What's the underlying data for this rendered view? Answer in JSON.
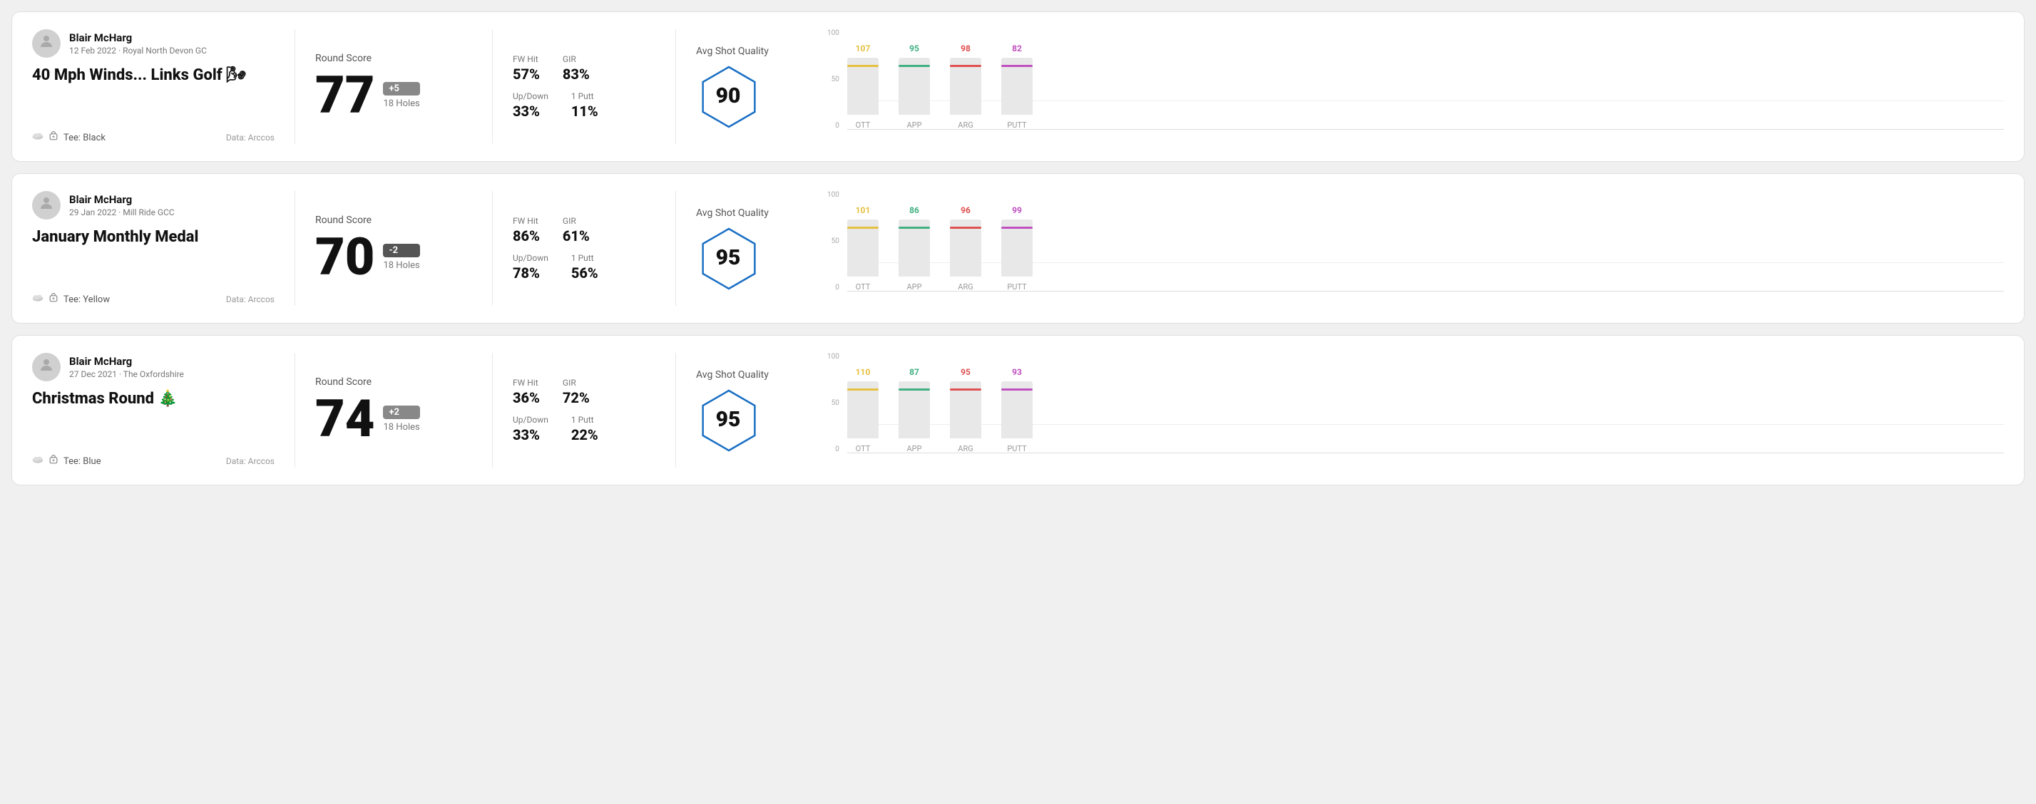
{
  "rounds": [
    {
      "id": "round-1",
      "user": {
        "name": "Blair McHarg",
        "date": "12 Feb 2022 · Royal North Devon GC"
      },
      "title": "40 Mph Winds... Links Golf",
      "title_emoji": "🌬",
      "tee": "Black",
      "data_source": "Data: Arccos",
      "score": {
        "label": "Round Score",
        "number": "77",
        "badge": "+5",
        "badge_type": "positive",
        "holes": "18 Holes"
      },
      "stats": {
        "fw_hit_label": "FW Hit",
        "fw_hit_value": "57%",
        "gir_label": "GIR",
        "gir_value": "83%",
        "updown_label": "Up/Down",
        "updown_value": "33%",
        "oneputt_label": "1 Putt",
        "oneputt_value": "11%"
      },
      "quality": {
        "label": "Avg Shot Quality",
        "score": "90"
      },
      "chart": {
        "bars": [
          {
            "label": "OTT",
            "value": 107,
            "color": "#e6c040",
            "max": 120
          },
          {
            "label": "APP",
            "value": 95,
            "color": "#40b080",
            "max": 120
          },
          {
            "label": "ARG",
            "value": 98,
            "color": "#e05050",
            "max": 120
          },
          {
            "label": "PUTT",
            "value": 82,
            "color": "#c050c0",
            "max": 120
          }
        ],
        "y_labels": [
          "100",
          "50",
          "0"
        ]
      }
    },
    {
      "id": "round-2",
      "user": {
        "name": "Blair McHarg",
        "date": "29 Jan 2022 · Mill Ride GCC"
      },
      "title": "January Monthly Medal",
      "title_emoji": "",
      "tee": "Yellow",
      "data_source": "Data: Arccos",
      "score": {
        "label": "Round Score",
        "number": "70",
        "badge": "-2",
        "badge_type": "negative",
        "holes": "18 Holes"
      },
      "stats": {
        "fw_hit_label": "FW Hit",
        "fw_hit_value": "86%",
        "gir_label": "GIR",
        "gir_value": "61%",
        "updown_label": "Up/Down",
        "updown_value": "78%",
        "oneputt_label": "1 Putt",
        "oneputt_value": "56%"
      },
      "quality": {
        "label": "Avg Shot Quality",
        "score": "95"
      },
      "chart": {
        "bars": [
          {
            "label": "OTT",
            "value": 101,
            "color": "#e6c040",
            "max": 120
          },
          {
            "label": "APP",
            "value": 86,
            "color": "#40b080",
            "max": 120
          },
          {
            "label": "ARG",
            "value": 96,
            "color": "#e05050",
            "max": 120
          },
          {
            "label": "PUTT",
            "value": 99,
            "color": "#c050c0",
            "max": 120
          }
        ],
        "y_labels": [
          "100",
          "50",
          "0"
        ]
      }
    },
    {
      "id": "round-3",
      "user": {
        "name": "Blair McHarg",
        "date": "27 Dec 2021 · The Oxfordshire"
      },
      "title": "Christmas Round",
      "title_emoji": "🎄",
      "tee": "Blue",
      "data_source": "Data: Arccos",
      "score": {
        "label": "Round Score",
        "number": "74",
        "badge": "+2",
        "badge_type": "positive",
        "holes": "18 Holes"
      },
      "stats": {
        "fw_hit_label": "FW Hit",
        "fw_hit_value": "36%",
        "gir_label": "GIR",
        "gir_value": "72%",
        "updown_label": "Up/Down",
        "updown_value": "33%",
        "oneputt_label": "1 Putt",
        "oneputt_value": "22%"
      },
      "quality": {
        "label": "Avg Shot Quality",
        "score": "95"
      },
      "chart": {
        "bars": [
          {
            "label": "OTT",
            "value": 110,
            "color": "#e6c040",
            "max": 120
          },
          {
            "label": "APP",
            "value": 87,
            "color": "#40b080",
            "max": 120
          },
          {
            "label": "ARG",
            "value": 95,
            "color": "#e05050",
            "max": 120
          },
          {
            "label": "PUTT",
            "value": 93,
            "color": "#c050c0",
            "max": 120
          }
        ],
        "y_labels": [
          "100",
          "50",
          "0"
        ]
      }
    }
  ],
  "ui": {
    "avatar_icon": "👤",
    "tee_weather_icon": "☁",
    "tee_bag_icon": "🏌",
    "data_label": "Data: Arccos"
  }
}
